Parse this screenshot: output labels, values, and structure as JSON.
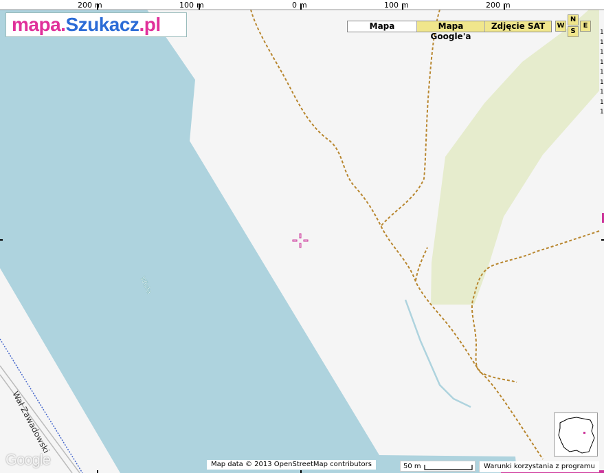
{
  "logo": {
    "part1": "mapa.",
    "part2": "Szukacz",
    "part3": ".pl"
  },
  "ruler_top": [
    {
      "value": "200",
      "unit": "m"
    },
    {
      "value": "100",
      "unit": "m"
    },
    {
      "value": "0",
      "unit": "m"
    },
    {
      "value": "100",
      "unit": "m"
    },
    {
      "value": "200",
      "unit": "m"
    }
  ],
  "map_types": {
    "map": "Mapa",
    "google": "Mapa Google'a",
    "sat": "Zdjęcie SAT"
  },
  "compass": {
    "n": "N",
    "s": "S",
    "w": "W",
    "e": "E"
  },
  "labels": {
    "river": "Wisła",
    "street": "Wał Zawadowski"
  },
  "attribution": "Map data © 2013 OpenStreetMap contributors",
  "scale": {
    "label": "50 m"
  },
  "terms": "Warunki korzystania z programu",
  "google_logo": "Google",
  "colors": {
    "water": "#aed3de",
    "park": "#e6eccd",
    "path": "#b8862e",
    "background": "#f5f5f5",
    "crosshair": "#cc3399"
  },
  "right_digits": [
    "1",
    "1",
    "1",
    "1",
    "1",
    "1",
    "1",
    "1",
    "1"
  ]
}
